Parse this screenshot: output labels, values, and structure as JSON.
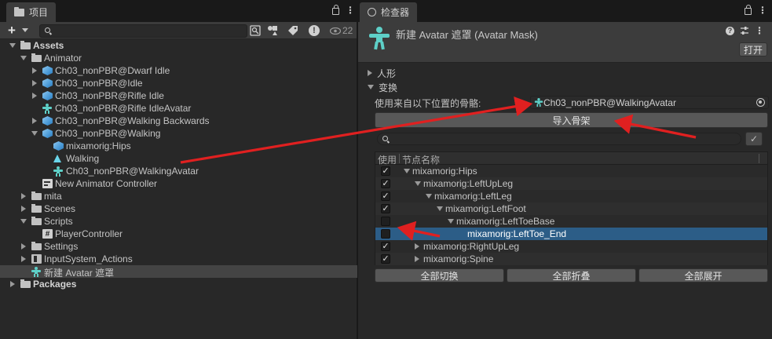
{
  "project_panel": {
    "tab_title": "项目",
    "hidden_count": "22",
    "tree": [
      {
        "label": "Assets",
        "depth": 0,
        "arrow": "down",
        "icon": "folder",
        "bold": true
      },
      {
        "label": "Animator",
        "depth": 1,
        "arrow": "down",
        "icon": "folder"
      },
      {
        "label": "Ch03_nonPBR@Dwarf Idle",
        "depth": 2,
        "arrow": "right",
        "icon": "model"
      },
      {
        "label": "Ch03_nonPBR@Idle",
        "depth": 2,
        "arrow": "right",
        "icon": "model"
      },
      {
        "label": "Ch03_nonPBR@Rifle Idle",
        "depth": 2,
        "arrow": "right",
        "icon": "model"
      },
      {
        "label": "Ch03_nonPBR@Rifle IdleAvatar",
        "depth": 2,
        "arrow": "none",
        "icon": "avatar"
      },
      {
        "label": "Ch03_nonPBR@Walking Backwards",
        "depth": 2,
        "arrow": "right",
        "icon": "model"
      },
      {
        "label": "Ch03_nonPBR@Walking",
        "depth": 2,
        "arrow": "down",
        "icon": "model"
      },
      {
        "label": "mixamorig:Hips",
        "depth": 3,
        "arrow": "none",
        "icon": "model"
      },
      {
        "label": "Walking",
        "depth": 3,
        "arrow": "none",
        "icon": "animation"
      },
      {
        "label": "Ch03_nonPBR@WalkingAvatar",
        "depth": 3,
        "arrow": "none",
        "icon": "avatar"
      },
      {
        "label": "New Animator Controller",
        "depth": 2,
        "arrow": "none",
        "icon": "controller"
      },
      {
        "label": "mita",
        "depth": 1,
        "arrow": "right",
        "icon": "folder"
      },
      {
        "label": "Scenes",
        "depth": 1,
        "arrow": "right",
        "icon": "folder"
      },
      {
        "label": "Scripts",
        "depth": 1,
        "arrow": "down",
        "icon": "folder"
      },
      {
        "label": "PlayerController",
        "depth": 2,
        "arrow": "none",
        "icon": "script"
      },
      {
        "label": "Settings",
        "depth": 1,
        "arrow": "right",
        "icon": "folder"
      },
      {
        "label": "InputSystem_Actions",
        "depth": 1,
        "arrow": "right",
        "icon": "input"
      },
      {
        "label": "新建 Avatar 遮罩",
        "depth": 1,
        "arrow": "none",
        "icon": "avatar",
        "selected": true
      },
      {
        "label": "Packages",
        "depth": 0,
        "arrow": "right",
        "icon": "folder",
        "bold": true
      }
    ]
  },
  "inspector": {
    "tab_title": "检查器",
    "asset_title": "新建 Avatar 遮罩 (Avatar Mask)",
    "open_button": "打开",
    "foldout_humanoid": "人形",
    "foldout_transform": "变换",
    "skeleton_source_label": "使用来自以下位置的骨骼:",
    "skeleton_source_value": "Ch03_nonPBR@WalkingAvatar",
    "import_button": "导入骨架",
    "table_header_use": "使用",
    "table_header_name": "节点名称",
    "bones": [
      {
        "name": "mixamorig:Hips",
        "depth": 0,
        "arrow": "down",
        "checked": true
      },
      {
        "name": "mixamorig:LeftUpLeg",
        "depth": 1,
        "arrow": "down",
        "checked": true
      },
      {
        "name": "mixamorig:LeftLeg",
        "depth": 2,
        "arrow": "down",
        "checked": true
      },
      {
        "name": "mixamorig:LeftFoot",
        "depth": 3,
        "arrow": "down",
        "checked": true
      },
      {
        "name": "mixamorig:LeftToeBase",
        "depth": 4,
        "arrow": "down",
        "checked": false
      },
      {
        "name": "mixamorig:LeftToe_End",
        "depth": 5,
        "arrow": "none",
        "checked": false,
        "selected": true
      },
      {
        "name": "mixamorig:RightUpLeg",
        "depth": 1,
        "arrow": "right",
        "checked": true
      },
      {
        "name": "mixamorig:Spine",
        "depth": 1,
        "arrow": "right",
        "checked": true
      }
    ],
    "toggle_all_button": "全部切换",
    "collapse_all_button": "全部折叠",
    "expand_all_button": "全部展开"
  },
  "annotation_color": "#e02020"
}
